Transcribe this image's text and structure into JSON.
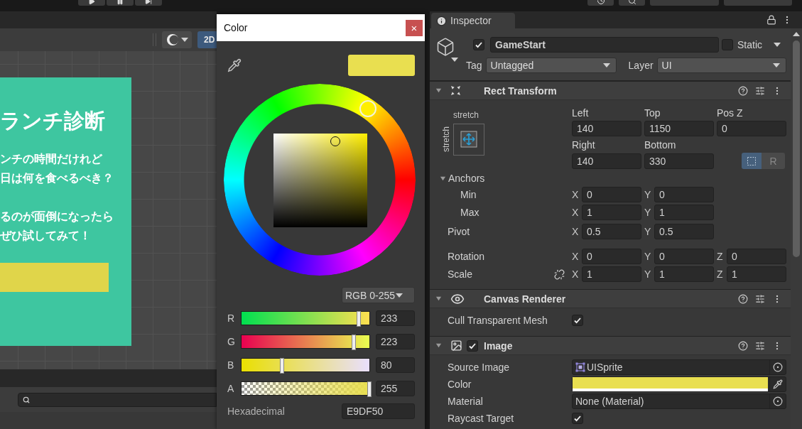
{
  "toolbar": {
    "dropdowns": [
      {
        "kind": "layers"
      },
      {
        "kind": "layout"
      }
    ]
  },
  "scene": {
    "mode_button": {
      "label": "2D",
      "selected": true
    },
    "card": {
      "title": "ランチ診断",
      "paragraphs": [
        [
          "ンチの時間だけれど",
          "日は何を食べるべき？"
        ],
        [
          "るのが面倒になったら",
          "ぜひ試してみて！"
        ]
      ]
    }
  },
  "color_picker": {
    "title": "Color",
    "close": "×",
    "mode": "RGB 0-255",
    "channels": [
      {
        "kind": "red",
        "label": "R",
        "level": 0.914,
        "value": "233"
      },
      {
        "kind": "green",
        "label": "G",
        "level": 0.875,
        "value": "223"
      },
      {
        "kind": "blue",
        "label": "B",
        "level": 0.314,
        "value": "80"
      },
      {
        "kind": "alpha",
        "label": "A",
        "level": 1,
        "value": "255"
      }
    ],
    "hex_label": "Hexadecimal",
    "hex": "E9DF50"
  },
  "inspector": {
    "tab": "Inspector",
    "object": {
      "active": true,
      "name": "GameStart",
      "static": false,
      "static_label": "Static",
      "tag_label": "Tag",
      "tag": "Untagged",
      "layer_label": "Layer",
      "layer": "UI"
    },
    "components": [
      {
        "kind": "rect_transform",
        "title": "Rect Transform",
        "expanded": true,
        "preset": {
          "horizontal": "stretch",
          "vertical": "stretch"
        },
        "fields": [
          {
            "label": "Left",
            "value": "140"
          },
          {
            "label": "Top",
            "value": "1150"
          },
          {
            "label": "Pos Z",
            "value": "0"
          },
          {
            "label": "Right",
            "value": "140"
          },
          {
            "label": "Bottom",
            "value": "330"
          }
        ],
        "edit_modes": [
          {
            "kind": "blueprint",
            "selected": true
          },
          {
            "kind": "raw",
            "label": "R",
            "selected": false
          }
        ],
        "anchors": {
          "label": "Anchors",
          "expanded": true,
          "children": [
            {
              "label": "Min",
              "axes": [
                {
                  "axis": "X",
                  "value": "0"
                },
                {
                  "axis": "Y",
                  "value": "0"
                }
              ]
            },
            {
              "label": "Max",
              "axes": [
                {
                  "axis": "X",
                  "value": "1"
                },
                {
                  "axis": "Y",
                  "value": "1"
                }
              ]
            }
          ]
        },
        "pivot": {
          "label": "Pivot",
          "axes": [
            {
              "axis": "X",
              "value": "0.5"
            },
            {
              "axis": "Y",
              "value": "0.5"
            }
          ]
        },
        "transform": [
          {
            "label": "Rotation",
            "axes": [
              {
                "axis": "X",
                "value": "0"
              },
              {
                "axis": "Y",
                "value": "0"
              },
              {
                "axis": "Z",
                "value": "0"
              }
            ]
          },
          {
            "label": "Scale",
            "linked": false,
            "axes": [
              {
                "axis": "X",
                "value": "1"
              },
              {
                "axis": "Y",
                "value": "1"
              },
              {
                "axis": "Z",
                "value": "1"
              }
            ]
          }
        ]
      },
      {
        "kind": "canvas_renderer",
        "title": "Canvas Renderer",
        "expanded": true,
        "properties": [
          {
            "kind": "toggle",
            "label": "Cull Transparent Mesh",
            "checked": true
          }
        ]
      },
      {
        "kind": "image",
        "title": "Image",
        "enabled": true,
        "expanded": true,
        "properties": [
          {
            "kind": "sprite_object",
            "label": "Source Image",
            "value": "UISprite"
          },
          {
            "kind": "color",
            "label": "Color"
          },
          {
            "kind": "object",
            "label": "Material",
            "value": "None (Material)"
          },
          {
            "kind": "toggle",
            "label": "Raycast Target",
            "checked": true
          }
        ]
      }
    ]
  }
}
